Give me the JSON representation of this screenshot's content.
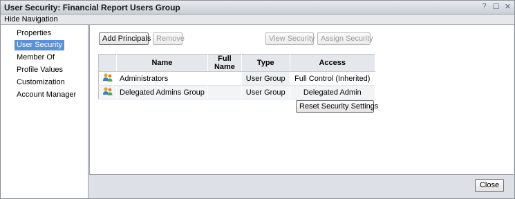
{
  "window": {
    "title": "User Security: Financial Report Users Group",
    "controls": {
      "help": "?",
      "maximize": "☐",
      "close": "✕"
    }
  },
  "toolbar": {
    "hide_navigation": "Hide Navigation"
  },
  "sidebar": {
    "items": [
      {
        "label": "Properties"
      },
      {
        "label": "User Security",
        "selected": true
      },
      {
        "label": "Member Of"
      },
      {
        "label": "Profile Values"
      },
      {
        "label": "Customization"
      },
      {
        "label": "Account Manager"
      }
    ]
  },
  "actions": {
    "add_principals": "Add Principals",
    "remove": "Remove",
    "view_security": "View Security",
    "assign_security": "Assign Security",
    "reset_security": "Reset Security Settings"
  },
  "table": {
    "columns": [
      "Name",
      "Full Name",
      "Type",
      "Access"
    ],
    "rows": [
      {
        "icon": "user-group-icon",
        "name": "Administrators",
        "full_name": "",
        "type": "User Group",
        "access": "Full Control (Inherited)"
      },
      {
        "icon": "user-group-icon",
        "name": "Delegated Admins Group",
        "full_name": "",
        "type": "User Group",
        "access": "Delegated Admin"
      }
    ]
  },
  "footer": {
    "close": "Close"
  },
  "colors": {
    "selected": "#5b8fd6",
    "titlebar": "#d4d8de",
    "footer": "#dde1e7"
  }
}
